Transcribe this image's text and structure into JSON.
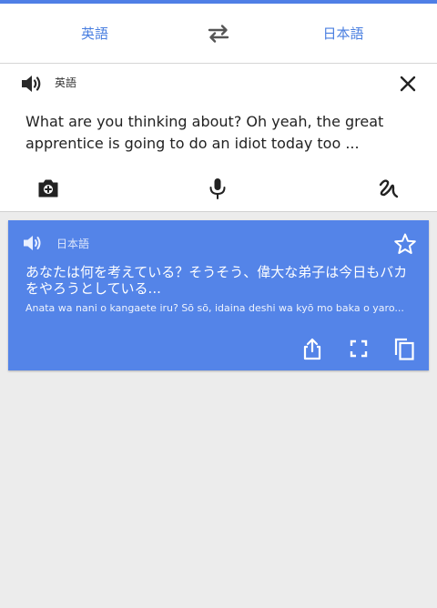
{
  "colors": {
    "accent": "#4f7fe6",
    "card": "#5484e8",
    "background": "#ececec"
  },
  "language_bar": {
    "source_language": "英語",
    "target_language": "日本語",
    "swap_icon": "swap-arrows-icon"
  },
  "input": {
    "speaker_icon": "speaker-icon",
    "language_label": "英語",
    "text": "What are you thinking about? Oh yeah, the great apprentice is going to do an idiot today too ...",
    "close_icon": "close-icon",
    "tools": [
      "camera-icon",
      "microphone-icon",
      "handwriting-icon"
    ]
  },
  "result": {
    "speaker_icon": "speaker-icon",
    "language_label": "日本語",
    "text": "あなたは何を考えている？そうそう、偉大な弟子は今日もバカをやろうとしている...",
    "transliteration": "Anata wa nani o kangaete iru? Sō sō, idaina deshi wa kyō mo baka o yaro...",
    "star_icon": "star-outline-icon",
    "actions": [
      "share-icon",
      "fullscreen-icon",
      "copy-icon"
    ]
  }
}
